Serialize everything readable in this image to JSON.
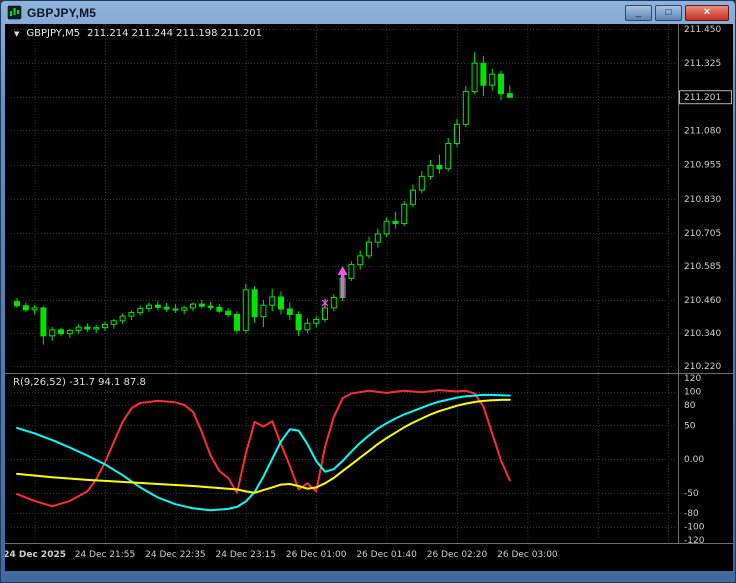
{
  "window": {
    "title": "GBPJPY,M5",
    "controls": {
      "minimize": "_",
      "maximize": "□",
      "close": "×"
    }
  },
  "chart_header": {
    "dropdown_icon": "▼",
    "symbol": "GBPJPY,M5",
    "ohlc": "211.214 211.244 211.198 211.201"
  },
  "chart_data": {
    "type": "candlestick",
    "symbol": "GBPJPY",
    "timeframe": "M5",
    "last_bar": {
      "open": 211.214,
      "high": 211.244,
      "low": 211.198,
      "close": 211.201
    },
    "colors": {
      "background": "#000000",
      "grid": "#343434",
      "candle": "#00e400",
      "bull_fill": "#000000",
      "bear_fill": "#00e400",
      "marker": "#ee55ee"
    },
    "price_axis": {
      "min": 210.22,
      "max": 211.45,
      "labels": [
        {
          "text": "211.450",
          "value": 211.45
        },
        {
          "text": "211.325",
          "value": 211.325
        },
        {
          "text": "211.080",
          "value": 211.08
        },
        {
          "text": "210.955",
          "value": 210.955
        },
        {
          "text": "210.830",
          "value": 210.83
        },
        {
          "text": "210.705",
          "value": 210.705
        },
        {
          "text": "210.585",
          "value": 210.585
        },
        {
          "text": "210.460",
          "value": 210.46
        },
        {
          "text": "210.340",
          "value": 210.34
        },
        {
          "text": "210.220",
          "value": 210.22
        }
      ],
      "hidden_grid_values": [
        211.2025
      ]
    },
    "current_price": {
      "text": "211.201",
      "value": 211.201
    },
    "time_labels": [
      {
        "text": "24 Dec 2025",
        "index": 2,
        "bold": true
      },
      {
        "text": "24 Dec 21:55",
        "index": 10
      },
      {
        "text": "24 Dec 22:35",
        "index": 18
      },
      {
        "text": "24 Dec 23:15",
        "index": 26
      },
      {
        "text": "26 Dec 01:00",
        "index": 34
      },
      {
        "text": "26 Dec 01:40",
        "index": 42
      },
      {
        "text": "26 Dec 02:20",
        "index": 50
      },
      {
        "text": "26 Dec 03:00",
        "index": 58
      }
    ],
    "extra_grid_indices": [
      66,
      74
    ],
    "candles": [
      [
        210.455,
        210.468,
        210.432,
        210.44
      ],
      [
        210.44,
        210.452,
        210.418,
        210.425
      ],
      [
        210.425,
        210.442,
        210.408,
        210.432
      ],
      [
        210.432,
        210.438,
        210.298,
        210.33
      ],
      [
        210.33,
        210.362,
        210.312,
        210.352
      ],
      [
        210.352,
        210.36,
        210.328,
        210.338
      ],
      [
        210.338,
        210.356,
        210.322,
        210.35
      ],
      [
        210.35,
        210.372,
        210.338,
        210.362
      ],
      [
        210.362,
        210.376,
        210.344,
        210.355
      ],
      [
        210.355,
        210.37,
        210.34,
        210.36
      ],
      [
        210.36,
        210.382,
        210.348,
        210.372
      ],
      [
        210.372,
        210.392,
        210.356,
        210.385
      ],
      [
        210.385,
        210.412,
        210.374,
        210.402
      ],
      [
        210.402,
        210.422,
        210.388,
        210.415
      ],
      [
        210.415,
        210.44,
        210.404,
        210.43
      ],
      [
        210.43,
        210.452,
        210.418,
        210.442
      ],
      [
        210.442,
        210.456,
        210.424,
        210.434
      ],
      [
        210.434,
        210.45,
        210.418,
        210.428
      ],
      [
        210.428,
        210.446,
        210.414,
        210.424
      ],
      [
        210.424,
        210.44,
        210.41,
        210.432
      ],
      [
        210.432,
        210.452,
        210.42,
        210.446
      ],
      [
        210.446,
        210.462,
        210.43,
        210.438
      ],
      [
        210.438,
        210.454,
        210.424,
        210.434
      ],
      [
        210.434,
        210.446,
        210.414,
        210.42
      ],
      [
        210.42,
        210.432,
        210.398,
        210.408
      ],
      [
        210.408,
        210.42,
        210.338,
        210.35
      ],
      [
        210.35,
        210.52,
        210.34,
        210.498
      ],
      [
        210.498,
        210.512,
        210.378,
        210.4
      ],
      [
        210.4,
        210.462,
        210.362,
        210.442
      ],
      [
        210.442,
        210.502,
        210.42,
        210.472
      ],
      [
        210.472,
        210.492,
        210.408,
        210.428
      ],
      [
        210.428,
        210.452,
        210.388,
        210.408
      ],
      [
        210.408,
        210.42,
        210.33,
        210.352
      ],
      [
        210.352,
        210.392,
        210.34,
        210.376
      ],
      [
        210.376,
        210.402,
        210.36,
        210.39
      ],
      [
        210.39,
        210.442,
        210.38,
        210.432
      ],
      [
        210.432,
        210.482,
        210.42,
        210.47
      ],
      [
        210.47,
        210.552,
        210.458,
        210.54
      ],
      [
        210.54,
        210.602,
        210.53,
        210.59
      ],
      [
        210.59,
        210.642,
        210.572,
        210.622
      ],
      [
        210.622,
        210.692,
        210.612,
        210.672
      ],
      [
        210.672,
        210.722,
        210.652,
        210.702
      ],
      [
        210.702,
        210.762,
        210.69,
        210.748
      ],
      [
        210.748,
        210.782,
        210.722,
        210.74
      ],
      [
        210.74,
        210.822,
        210.73,
        210.81
      ],
      [
        210.81,
        210.882,
        210.8,
        210.862
      ],
      [
        210.862,
        210.932,
        210.85,
        210.912
      ],
      [
        210.912,
        210.972,
        210.9,
        210.952
      ],
      [
        210.952,
        210.992,
        210.922,
        210.94
      ],
      [
        210.94,
        211.052,
        210.93,
        211.032
      ],
      [
        211.032,
        211.122,
        211.02,
        211.102
      ],
      [
        211.102,
        211.242,
        211.092,
        211.222
      ],
      [
        211.222,
        211.365,
        211.212,
        211.325
      ],
      [
        211.325,
        211.352,
        211.205,
        211.245
      ],
      [
        211.245,
        211.305,
        211.225,
        211.285
      ],
      [
        211.285,
        211.298,
        211.19,
        211.214
      ],
      [
        211.214,
        211.244,
        211.198,
        211.201
      ]
    ],
    "markers": [
      {
        "type": "buy-arrow",
        "index": 37,
        "price_tip": 210.585,
        "price_tail": 210.468,
        "color": "#ee55ee"
      },
      {
        "type": "star",
        "index": 35,
        "price": 210.45,
        "color": "#ee55ee"
      }
    ],
    "oscillator": {
      "label": "R(9,26,52) -31.7 94.1 87.8",
      "values": {
        "red": -31.7,
        "cyan": 94.1,
        "yellow": 87.8
      },
      "range": [
        -120,
        120
      ],
      "axis_labels": [
        {
          "text": "120",
          "value": 120
        },
        {
          "text": "100",
          "value": 100
        },
        {
          "text": "80",
          "value": 80
        },
        {
          "text": "50",
          "value": 50
        },
        {
          "text": "0.00",
          "value": 0
        },
        {
          "text": "-50",
          "value": -50
        },
        {
          "text": "-80",
          "value": -80
        },
        {
          "text": "-100",
          "value": -100
        },
        {
          "text": "-120",
          "value": -120
        }
      ],
      "grid_levels": [
        100,
        80,
        50,
        0,
        -50,
        -80,
        -100
      ],
      "series": [
        {
          "name": "red",
          "color": "#ff2e2e",
          "points": [
            [
              0,
              -52
            ],
            [
              2,
              -62
            ],
            [
              4,
              -70
            ],
            [
              6,
              -62
            ],
            [
              8,
              -48
            ],
            [
              9,
              -30
            ],
            [
              10,
              -5
            ],
            [
              11,
              25
            ],
            [
              12,
              55
            ],
            [
              13,
              75
            ],
            [
              14,
              83
            ],
            [
              16,
              86
            ],
            [
              18,
              84
            ],
            [
              19,
              80
            ],
            [
              20,
              70
            ],
            [
              21,
              40
            ],
            [
              22,
              5
            ],
            [
              23,
              -18
            ],
            [
              24,
              -28
            ],
            [
              25,
              -50
            ],
            [
              26,
              8
            ],
            [
              27,
              55
            ],
            [
              28,
              48
            ],
            [
              29,
              56
            ],
            [
              30,
              22
            ],
            [
              31,
              -10
            ],
            [
              32,
              -45
            ],
            [
              33,
              -36
            ],
            [
              34,
              -48
            ],
            [
              35,
              18
            ],
            [
              36,
              62
            ],
            [
              37,
              90
            ],
            [
              38,
              97
            ],
            [
              40,
              101
            ],
            [
              42,
              98
            ],
            [
              44,
              101
            ],
            [
              46,
              99
            ],
            [
              48,
              102
            ],
            [
              50,
              100
            ],
            [
              51,
              101
            ],
            [
              52,
              97
            ],
            [
              53,
              78
            ],
            [
              54,
              38
            ],
            [
              55,
              -2
            ],
            [
              56,
              -31.7
            ]
          ]
        },
        {
          "name": "cyan",
          "color": "#00ffff",
          "points": [
            [
              0,
              46
            ],
            [
              2,
              38
            ],
            [
              4,
              28
            ],
            [
              6,
              17
            ],
            [
              8,
              5
            ],
            [
              10,
              -8
            ],
            [
              12,
              -24
            ],
            [
              14,
              -42
            ],
            [
              16,
              -57
            ],
            [
              18,
              -67
            ],
            [
              20,
              -73
            ],
            [
              22,
              -76
            ],
            [
              24,
              -74
            ],
            [
              25,
              -71
            ],
            [
              26,
              -63
            ],
            [
              27,
              -49
            ],
            [
              28,
              -26
            ],
            [
              29,
              0
            ],
            [
              30,
              26
            ],
            [
              31,
              44
            ],
            [
              32,
              42
            ],
            [
              33,
              22
            ],
            [
              34,
              -3
            ],
            [
              35,
              -19
            ],
            [
              36,
              -15
            ],
            [
              37,
              -3
            ],
            [
              38,
              11
            ],
            [
              39,
              24
            ],
            [
              40,
              35
            ],
            [
              41,
              45
            ],
            [
              42,
              53
            ],
            [
              43,
              60
            ],
            [
              44,
              66
            ],
            [
              45,
              71
            ],
            [
              46,
              76
            ],
            [
              47,
              81
            ],
            [
              48,
              85
            ],
            [
              49,
              88
            ],
            [
              50,
              91
            ],
            [
              51,
              93
            ],
            [
              52,
              94
            ],
            [
              53,
              95
            ],
            [
              54,
              95
            ],
            [
              55,
              94.5
            ],
            [
              56,
              94.1
            ]
          ]
        },
        {
          "name": "yellow",
          "color": "#ffff00",
          "points": [
            [
              0,
              -22
            ],
            [
              4,
              -27
            ],
            [
              8,
              -31
            ],
            [
              12,
              -34
            ],
            [
              16,
              -37
            ],
            [
              20,
              -40
            ],
            [
              22,
              -42
            ],
            [
              24,
              -44
            ],
            [
              25,
              -45
            ],
            [
              26,
              -48
            ],
            [
              27,
              -50
            ],
            [
              28,
              -46
            ],
            [
              29,
              -42
            ],
            [
              30,
              -38
            ],
            [
              31,
              -37
            ],
            [
              32,
              -40
            ],
            [
              33,
              -44
            ],
            [
              34,
              -42
            ],
            [
              35,
              -36
            ],
            [
              36,
              -28
            ],
            [
              37,
              -18
            ],
            [
              38,
              -8
            ],
            [
              39,
              2
            ],
            [
              40,
              12
            ],
            [
              41,
              22
            ],
            [
              42,
              31
            ],
            [
              43,
              39
            ],
            [
              44,
              47
            ],
            [
              45,
              54
            ],
            [
              46,
              60
            ],
            [
              47,
              66
            ],
            [
              48,
              71
            ],
            [
              49,
              75
            ],
            [
              50,
              79
            ],
            [
              51,
              82
            ],
            [
              52,
              84.5
            ],
            [
              53,
              86
            ],
            [
              54,
              87
            ],
            [
              55,
              87.6
            ],
            [
              56,
              87.8
            ]
          ]
        }
      ]
    }
  }
}
